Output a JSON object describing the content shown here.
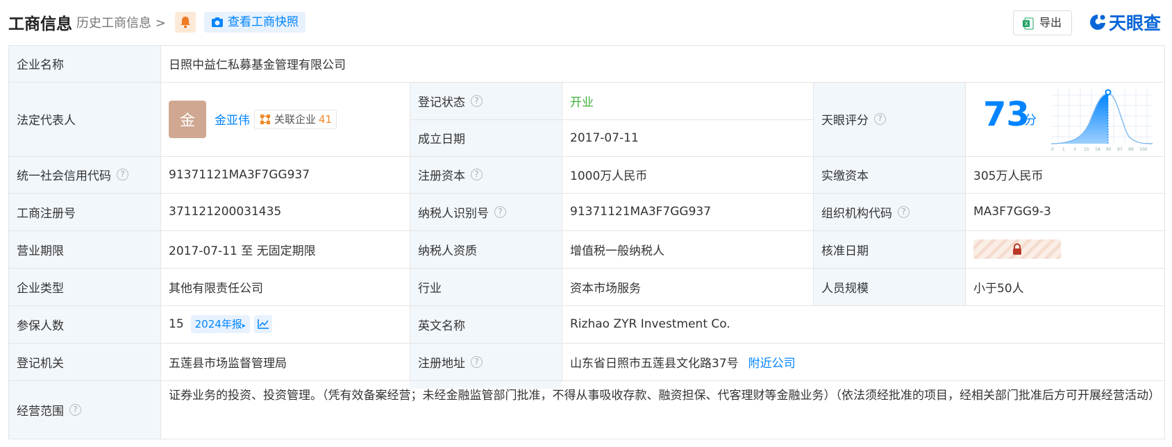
{
  "header": {
    "title": "工商信息",
    "history_link": "历史工商信息 >",
    "snapshot_button": "查看工商快照",
    "export_button": "导出",
    "logo_text": "天眼查"
  },
  "rows": {
    "company_name": {
      "label": "企业名称",
      "value": "日照中益仁私募基金管理有限公司"
    },
    "legal_rep": {
      "label": "法定代表人",
      "avatar_char": "金",
      "name": "金亚伟",
      "related_label": "关联企业",
      "related_count": "41"
    },
    "reg_status": {
      "label": "登记状态",
      "value": "开业"
    },
    "founded": {
      "label": "成立日期",
      "value": "2017-07-11"
    },
    "score": {
      "label": "天眼评分",
      "value": "73",
      "unit": "分"
    },
    "credit_code": {
      "label": "统一社会信用代码",
      "value": "91371121MA3F7GG937"
    },
    "reg_capital": {
      "label": "注册资本",
      "value": "1000万人民币"
    },
    "paid_capital": {
      "label": "实缴资本",
      "value": "305万人民币"
    },
    "reg_number": {
      "label": "工商注册号",
      "value": "371121200031435"
    },
    "taxpayer_id": {
      "label": "纳税人识别号",
      "value": "91371121MA3F7GG937"
    },
    "org_code": {
      "label": "组织机构代码",
      "value": "MA3F7GG9-3"
    },
    "term": {
      "label": "营业期限",
      "value": "2017-07-11 至 无固定期限"
    },
    "taxpayer_type": {
      "label": "纳税人资质",
      "value": "增值税一般纳税人"
    },
    "approval_date": {
      "label": "核准日期",
      "value": ""
    },
    "company_type": {
      "label": "企业类型",
      "value": "其他有限责任公司"
    },
    "industry": {
      "label": "行业",
      "value": "资本市场服务"
    },
    "staff_size": {
      "label": "人员规模",
      "value": "小于50人"
    },
    "insured": {
      "label": "参保人数",
      "value": "15",
      "report_tag": "2024年报"
    },
    "english_name": {
      "label": "英文名称",
      "value": "Rizhao ZYR Investment Co."
    },
    "authority": {
      "label": "登记机关",
      "value": "五莲县市场监督管理局"
    },
    "address": {
      "label": "注册地址",
      "value": "山东省日照市五莲县文化路37号",
      "link": "附近公司"
    },
    "scope": {
      "label": "经营范围",
      "value": "证券业务的投资、投资管理。（凭有效备案经营；未经金融监管部门批准，不得从事吸收存款、融资担保、代客理财等金融业务）（依法须经批准的项目，经相关部门批准后方可开展经营活动）"
    }
  },
  "score_chart": {
    "axis_ticks": [
      "0",
      "1",
      "3",
      "15",
      "18",
      "65",
      "97",
      "99",
      "100"
    ]
  },
  "colors": {
    "accent": "#0084ff",
    "status_green": "#43b23c",
    "label_bg": "#f2f7fc",
    "border": "#e4e4e4"
  }
}
